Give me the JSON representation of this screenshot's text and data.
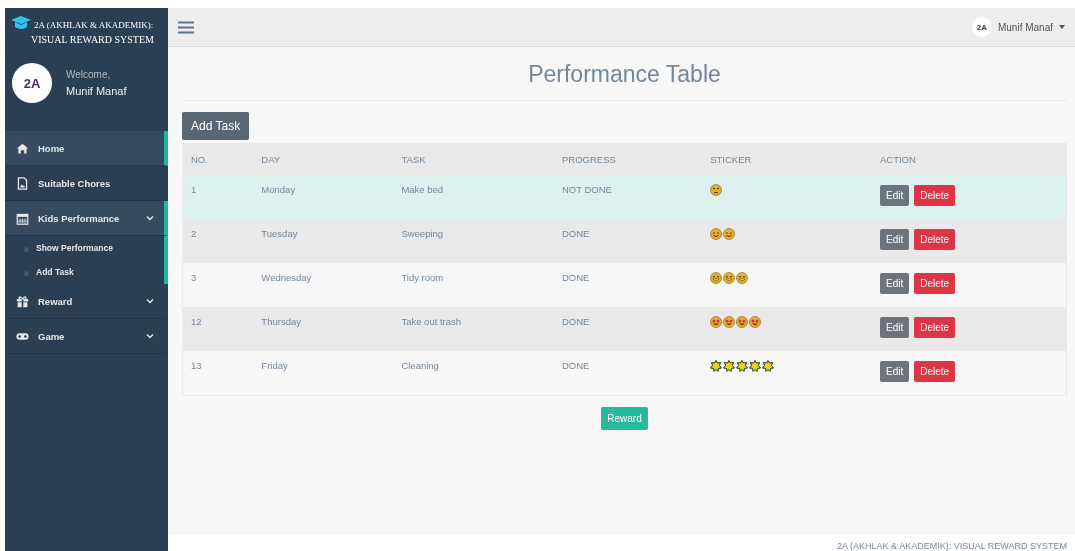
{
  "brand": {
    "title": "2A (AKHLAK & AKADEMIK):",
    "subtitle": "VISUAL REWARD SYSTEM"
  },
  "profile": {
    "avatar_text": "2A",
    "greeting": "Welcome,",
    "name": "Munif Manaf"
  },
  "sidebar": {
    "items": [
      {
        "label": "Home",
        "kind": "link",
        "selected": true
      },
      {
        "label": "Suitable Chores",
        "kind": "link",
        "selected": false
      },
      {
        "label": "Kids Performance",
        "kind": "menu",
        "selected": true,
        "expanded": true,
        "children": [
          {
            "label": "Show Performance",
            "selected": false
          },
          {
            "label": "Add Task",
            "selected": false
          }
        ]
      },
      {
        "label": "Reward",
        "kind": "menu",
        "selected": false,
        "expanded": false
      },
      {
        "label": "Game",
        "kind": "menu",
        "selected": false,
        "expanded": false
      }
    ]
  },
  "topbar": {
    "avatar_text": "2A",
    "user": "Munif Manaf"
  },
  "page_title": "Performance Table",
  "add_button": "Add Task",
  "table": {
    "columns": [
      "NO.",
      "DAY",
      "TASK",
      "PROGRESS",
      "STICKER",
      "ACTION"
    ],
    "rows": [
      {
        "no": "1",
        "day": "Monday",
        "task": "Make bed",
        "progress": "NOT DONE",
        "stickers": [
          {
            "kind": "angry"
          }
        ],
        "edit": "Edit",
        "delete": "Delete",
        "selected": true
      },
      {
        "no": "2",
        "day": "Tuesday",
        "task": "Sweeping",
        "progress": "DONE",
        "stickers": [
          {
            "kind": "smile"
          },
          {
            "kind": "smile"
          }
        ],
        "edit": "Edit",
        "delete": "Delete",
        "selected": false
      },
      {
        "no": "3",
        "day": "Wednesday",
        "task": "Tidy room",
        "progress": "DONE",
        "stickers": [
          {
            "kind": "grin"
          },
          {
            "kind": "grin"
          },
          {
            "kind": "grin"
          }
        ],
        "edit": "Edit",
        "delete": "Delete",
        "selected": false
      },
      {
        "no": "12",
        "day": "Thursday",
        "task": "Take out trash",
        "progress": "DONE",
        "stickers": [
          {
            "kind": "heart"
          },
          {
            "kind": "heart"
          },
          {
            "kind": "heart"
          },
          {
            "kind": "heart"
          }
        ],
        "edit": "Edit",
        "delete": "Delete",
        "selected": false
      },
      {
        "no": "13",
        "day": "Friday",
        "task": "Cleaning",
        "progress": "DONE",
        "stickers": [
          {
            "kind": "star"
          },
          {
            "kind": "star"
          },
          {
            "kind": "star"
          },
          {
            "kind": "star"
          },
          {
            "kind": "star"
          }
        ],
        "edit": "Edit",
        "delete": "Delete",
        "selected": false
      }
    ]
  },
  "reward_button": "Reward",
  "footer": "2A (AKHLAK & AKADEMIK): VISUAL REWARD SYSTEM"
}
